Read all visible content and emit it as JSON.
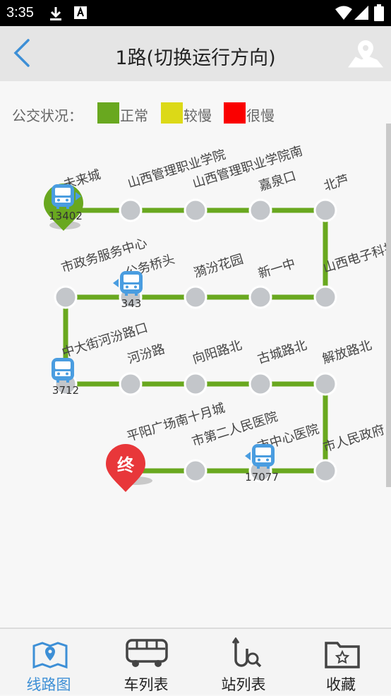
{
  "status_bar": {
    "time": "3:35"
  },
  "header": {
    "title": "1路(切换运行方向)"
  },
  "legend": {
    "label": "公交状况：",
    "items": [
      {
        "name": "正常",
        "color": "#69a81f"
      },
      {
        "name": "较慢",
        "color": "#dcd917"
      },
      {
        "name": "很慢",
        "color": "#fa0000"
      }
    ]
  },
  "route": {
    "line_color": "#69a81f",
    "stations": [
      {
        "name": "未来城"
      },
      {
        "name": "山西管理职业学院"
      },
      {
        "name": "山西管理职业学院南"
      },
      {
        "name": "嘉泉口"
      },
      {
        "name": "北芦"
      },
      {
        "name": "山西电子科技学院"
      },
      {
        "name": "新一中"
      },
      {
        "name": "漪汾花园"
      },
      {
        "name": "公务桥头"
      },
      {
        "name": "市政务服务中心"
      },
      {
        "name": "中大街河汾路口"
      },
      {
        "name": "河汾路"
      },
      {
        "name": "向阳路北"
      },
      {
        "name": "古城路北"
      },
      {
        "name": "解放路北"
      },
      {
        "name": "市人民政府"
      },
      {
        "name": "市中心医院"
      },
      {
        "name": "市第二人民医院"
      },
      {
        "name": "平阳广场南十月城"
      }
    ],
    "end_marker": "终",
    "buses": [
      {
        "plate": "13402"
      },
      {
        "plate": "343"
      },
      {
        "plate": "3712"
      },
      {
        "plate": "17077"
      }
    ]
  },
  "tabs": [
    {
      "label": "线路图",
      "icon": "route-map-icon",
      "active": true
    },
    {
      "label": "车列表",
      "icon": "bus-list-icon",
      "active": false
    },
    {
      "label": "站列表",
      "icon": "station-search-icon",
      "active": false
    },
    {
      "label": "收藏",
      "icon": "favorites-folder-icon",
      "active": false
    }
  ]
}
